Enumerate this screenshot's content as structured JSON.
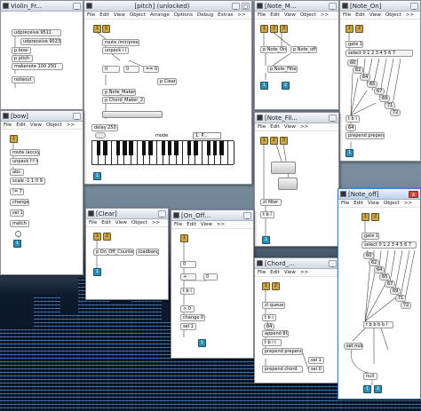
{
  "windows": {
    "violin": {
      "title": "Violin_Fr...",
      "boxes": [
        "udpreceive 9511",
        "udpreceive 9023",
        "p bow",
        "p pitch",
        "makenote 100 250",
        "noteout"
      ]
    },
    "pitch": {
      "title": "[pitch] (unlocked)",
      "menu": [
        "File",
        "Edit",
        "View",
        "Object",
        "Arrange",
        "Options",
        "Debug",
        "Extras",
        ">>"
      ],
      "boxes": [
        "route /mir/press",
        "unpack i i i",
        "0",
        "0",
        "== 0",
        "p Clear",
        "p Note_Maker",
        "p Chord_Maker_2",
        "delay 250",
        "mode",
        "1: P..."
      ],
      "inlets": [
        "1",
        "2"
      ],
      "outlets": [
        "1"
      ]
    },
    "note_m": {
      "title": "[Note_M...",
      "menu": [
        "File",
        "Edit",
        "View",
        "Object",
        ">>"
      ],
      "boxes": [
        "p Note_On",
        "p Note_off",
        "p Note_Filter"
      ],
      "inlets": [
        "1",
        "2",
        "3"
      ],
      "outlets": [
        "1",
        "2"
      ]
    },
    "note_on": {
      "title": "[Note_On]",
      "menu": [
        "File",
        "Edit",
        "View",
        "Object",
        ">>"
      ],
      "boxes": [
        "gate 1",
        "select 0 1 2 3 4 5 6 7",
        "60",
        "62",
        "64",
        "65",
        "67",
        "69",
        "71",
        "72",
        "t b i",
        "64",
        "prepend prepend"
      ],
      "inlets": [
        "1",
        "2"
      ],
      "outlets": [
        "1"
      ]
    },
    "bow": {
      "title": "[bow]",
      "menu": [
        "File",
        "Edit",
        "View",
        "Object",
        ">>"
      ],
      "boxes": [
        "route /accxyz",
        "unpack f f f",
        "abs",
        "scale -1 1 0 9",
        "!= 7",
        "change",
        "sel 1",
        "match 1"
      ],
      "inlets": [
        "1"
      ],
      "outlets": [
        "1"
      ]
    },
    "note_fil": {
      "title": "[Note_Fil...",
      "menu": [
        "File",
        "Edit",
        "View",
        ">>"
      ],
      "boxes": [
        "zl filter",
        "t b l"
      ],
      "inlets": [
        "1",
        "2",
        "3"
      ],
      "outlets": [
        "1"
      ]
    },
    "clear": {
      "title": "[Clear]",
      "menu": [
        "File",
        "Edit",
        "View",
        "Object",
        ">>"
      ],
      "boxes": [
        "p On_Off_Counter",
        "loadbang"
      ],
      "inlets": [
        "1",
        "2"
      ],
      "outlets": [
        "1"
      ]
    },
    "on_off": {
      "title": "[On_Off...",
      "menu": [
        "File",
        "Edit",
        "View",
        ">>"
      ],
      "boxes": [
        "0",
        "+",
        "0",
        "t b i",
        "> 0",
        "change 0",
        "sel 1"
      ],
      "inlets": [
        "1"
      ],
      "outlets": [
        "1"
      ]
    },
    "chord": {
      "title": "[Chord_...",
      "menu": [
        "File",
        "Edit",
        "View",
        ">>"
      ],
      "boxes": [
        "zl queue",
        "t b i",
        "64",
        "append 80",
        "t b i l",
        "prepend prepend",
        "sel 1",
        "prepend chord",
        "sel 0"
      ],
      "inlets": [
        "1",
        "2"
      ],
      "outlets": [
        "1"
      ]
    },
    "note_off": {
      "title": "[Note_off]",
      "menu": [
        "File",
        "Edit",
        "View",
        "Object",
        ">>"
      ],
      "boxes": [
        "gate 1",
        "select 0 1 2 3 4 5 6 7",
        "60",
        "62",
        "64",
        "65",
        "67",
        "69",
        "71",
        "72",
        "t b b b b l",
        "set null",
        "null"
      ],
      "inlets": [
        "1",
        "2"
      ],
      "outlets": [
        "1",
        "2"
      ]
    }
  },
  "controls": {
    "minimize": "_",
    "maximize": "□",
    "close": "x"
  },
  "colors": {
    "inlet": "#c8a54a",
    "outlet": "#2f8fb5",
    "close": "#c9483e",
    "active_border": "#4a7cc4"
  },
  "icons": [
    "app-icon",
    "close-icon",
    "minimize-icon",
    "maximize-icon",
    "inlet-icon",
    "outlet-icon"
  ]
}
